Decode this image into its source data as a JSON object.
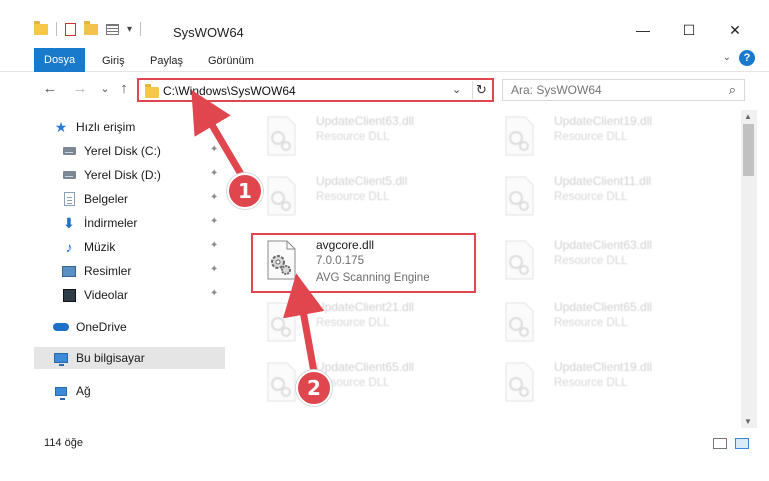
{
  "window": {
    "title": "SysWOW64",
    "qat_dropdown": "▾",
    "minimize": "—",
    "maximize": "☐",
    "close": "✕"
  },
  "ribbon": {
    "tabs": [
      "Dosya",
      "Giriş",
      "Paylaş",
      "Görünüm"
    ],
    "help": "?",
    "collapse": "⌄"
  },
  "nav": {
    "back": "←",
    "forward": "→",
    "recent": "⌄",
    "up": "↑",
    "address_path": "C:\\Windows\\SysWOW64",
    "address_dropdown": "⌄",
    "refresh": "↻",
    "search_placeholder": "Ara: SysWOW64",
    "search_icon": "⌕"
  },
  "sidebar": {
    "items": [
      {
        "label": "Hızlı erişim",
        "icon": "star-icon",
        "pinned": false
      },
      {
        "label": "Yerel Disk (C:)",
        "icon": "disk-icon",
        "pinned": true
      },
      {
        "label": "Yerel Disk (D:)",
        "icon": "disk-icon",
        "pinned": true
      },
      {
        "label": "Belgeler",
        "icon": "documents-icon",
        "pinned": true
      },
      {
        "label": "İndirmeler",
        "icon": "download-icon",
        "pinned": true
      },
      {
        "label": "Müzik",
        "icon": "music-icon",
        "pinned": true
      },
      {
        "label": "Resimler",
        "icon": "pictures-icon",
        "pinned": true
      },
      {
        "label": "Videolar",
        "icon": "videos-icon",
        "pinned": true
      },
      {
        "label": "OneDrive",
        "icon": "onedrive-icon",
        "pinned": false
      },
      {
        "label": "Bu bilgisayar",
        "icon": "computer-icon",
        "pinned": false
      },
      {
        "label": "Ağ",
        "icon": "network-icon",
        "pinned": false
      }
    ],
    "pin_glyph": "📌"
  },
  "files": {
    "left_column": [
      {
        "name": "UpdateClient63.dll",
        "type": "Resource DLL"
      },
      {
        "name": "UpdateClient5.dll",
        "type": "Resource DLL"
      },
      {
        "name": "avgcore.dll",
        "version": "7.0.0.175",
        "description": "AVG Scanning Engine"
      },
      {
        "name": "UpdateClient21.dll",
        "type": "Resource DLL"
      },
      {
        "name": "UpdateClient65.dll",
        "type": "Resource DLL"
      }
    ],
    "right_column": [
      {
        "name": "UpdateClient19.dll",
        "type": "Resource DLL"
      },
      {
        "name": "UpdateClient11.dll",
        "type": "Resource DLL"
      },
      {
        "name": "UpdateClient63.dll",
        "type": "Resource DLL"
      },
      {
        "name": "UpdateClient65.dll",
        "type": "Resource DLL"
      },
      {
        "name": "UpdateClient19.dll",
        "type": "Resource DLL"
      }
    ]
  },
  "status": {
    "item_count": "114 öğe"
  },
  "annotations": {
    "step1": "1",
    "step2": "2",
    "color": "#e0464d"
  },
  "colors": {
    "accent": "#1979ca",
    "selection": "#cce8ff",
    "annotation_red": "#e0464d"
  }
}
